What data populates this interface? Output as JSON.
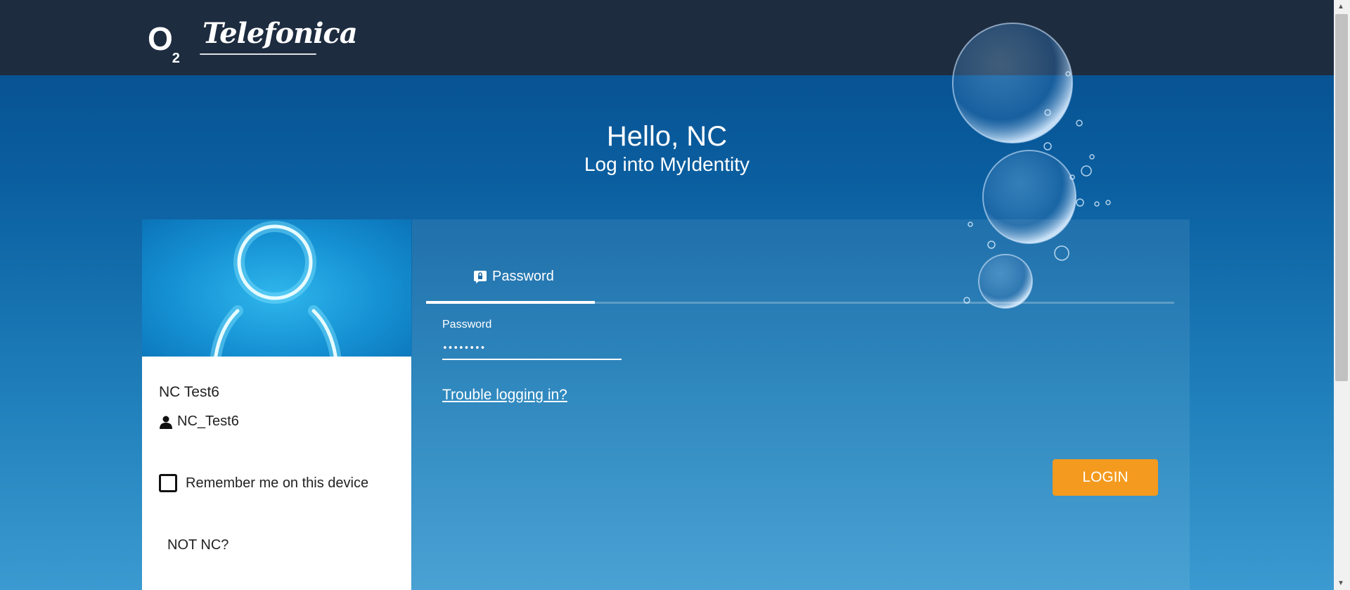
{
  "header": {
    "logo_o2": "O",
    "logo_o2_sub": "2",
    "logo_brand": "Telefonica"
  },
  "main": {
    "greeting": "Hello, NC",
    "subtitle": "Log into MyIdentity"
  },
  "profile": {
    "display_name": "NC Test6",
    "username": "NC_Test6",
    "remember_label": "Remember me on this device",
    "remember_checked": false,
    "not_user_label": "NOT NC?"
  },
  "login_form": {
    "tab_label": "Password",
    "password_label": "Password",
    "password_value": "••••••••",
    "trouble_link": "Trouble logging in?",
    "login_button": "LOGIN"
  },
  "icons": {
    "tab_icon": "lock-chat-icon",
    "user_icon": "person-icon"
  },
  "colors": {
    "topbar": "#1e2c40",
    "background": "#0a5e9f",
    "login_button": "#f49a1e"
  }
}
